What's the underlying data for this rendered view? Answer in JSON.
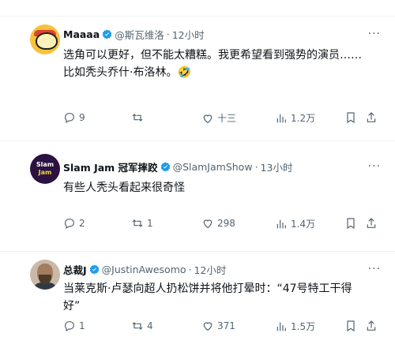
{
  "tweets": [
    {
      "name": "Maaaa",
      "handle": "@斯瓦维洛",
      "dot": "·",
      "time": "12小时",
      "text": "选角可以更好，但不能太糟糕。我更希望看到强势的演员……比如秃头乔什·布洛林。🤣",
      "stats": {
        "reply": "9",
        "retweet": "",
        "like": "十三",
        "views": "1.2万"
      }
    },
    {
      "name": "Slam Jam 冠军摔跤",
      "handle": "@SlamJamShow",
      "dot": "·",
      "time": "13小时",
      "text": "有些人秃头看起来很奇怪",
      "avatar_text": [
        "Slam",
        "Jam"
      ],
      "stats": {
        "reply": "2",
        "retweet": "1",
        "like": "298",
        "views": "1.4万"
      }
    },
    {
      "name": "总裁J",
      "handle": "@JustinAwesomo",
      "dot": "·",
      "time": "12小时",
      "text": "当莱克斯·卢瑟向超人扔松饼并将他打晕时：“47号特工干得好”",
      "stats": {
        "reply": "1",
        "retweet": "4",
        "like": "371",
        "views": "1.5万"
      }
    }
  ],
  "colors": {
    "text": "#0f1419",
    "muted": "#536471",
    "verified": "#1d9bf0",
    "divider": "#eff3f4"
  },
  "icons": [
    "reply-icon",
    "retweet-icon",
    "like-icon",
    "views-icon",
    "bookmark-icon",
    "share-icon",
    "more-icon",
    "verified-icon"
  ]
}
